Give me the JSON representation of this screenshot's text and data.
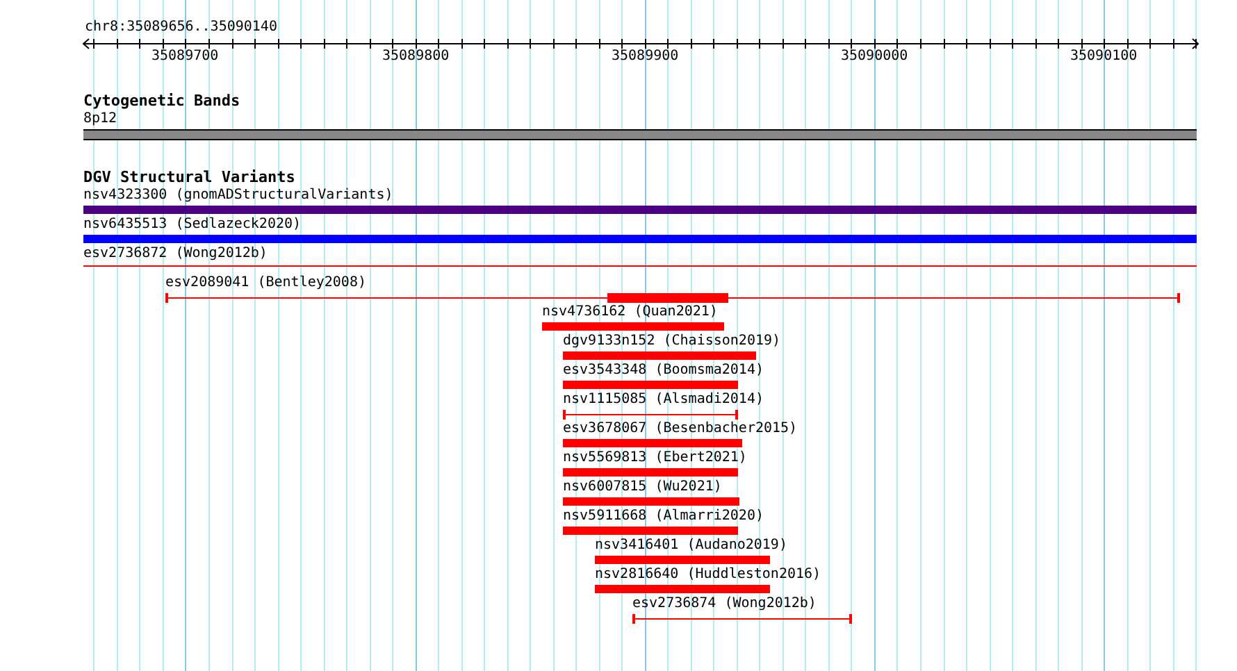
{
  "ruler": {
    "label": "chr8:35089656..35090140",
    "tick_labels": [
      "35089700",
      "35089800",
      "35089900",
      "35090000",
      "35090100"
    ]
  },
  "tracks": [
    {
      "title": "Cytogenetic Bands",
      "items": [
        {
          "kind": "band",
          "label": "8p12",
          "color": "#888888"
        }
      ]
    },
    {
      "title": "DGV Structural Variants",
      "items": [
        {
          "kind": "block",
          "label": "nsv4323300 (gnomADStructuralVariants)",
          "color": "#4b0082"
        },
        {
          "kind": "block",
          "label": "nsv6435513 (Sedlazeck2020)",
          "color": "#0000ff"
        },
        {
          "kind": "line",
          "label": "esv2736872 (Wong2012b)",
          "color": "#ff0000"
        },
        {
          "kind": "line_block",
          "label": "esv2089041 (Bentley2008)",
          "color": "#ff0000"
        },
        {
          "kind": "block",
          "label": "nsv4736162 (Quan2021)",
          "color": "#ff0000"
        },
        {
          "kind": "block",
          "label": "dgv9133n152 (Chaisson2019)",
          "color": "#ff0000"
        },
        {
          "kind": "block",
          "label": "esv3543348 (Boomsma2014)",
          "color": "#ff0000"
        },
        {
          "kind": "line",
          "label": "nsv1115085 (Alsmadi2014)",
          "color": "#ff0000"
        },
        {
          "kind": "block",
          "label": "esv3678067 (Besenbacher2015)",
          "color": "#ff0000"
        },
        {
          "kind": "block",
          "label": "nsv5569813 (Ebert2021)",
          "color": "#ff0000"
        },
        {
          "kind": "block",
          "label": "nsv6007815 (Wu2021)",
          "color": "#ff0000"
        },
        {
          "kind": "block",
          "label": "nsv5911668 (Almarri2020)",
          "color": "#ff0000"
        },
        {
          "kind": "block",
          "label": "nsv3416401 (Audano2019)",
          "color": "#ff0000"
        },
        {
          "kind": "block",
          "label": "nsv2816640 (Huddleston2016)",
          "color": "#ff0000"
        },
        {
          "kind": "line",
          "label": "esv2736874 (Wong2012b)",
          "color": "#ff0000"
        }
      ]
    }
  ]
}
